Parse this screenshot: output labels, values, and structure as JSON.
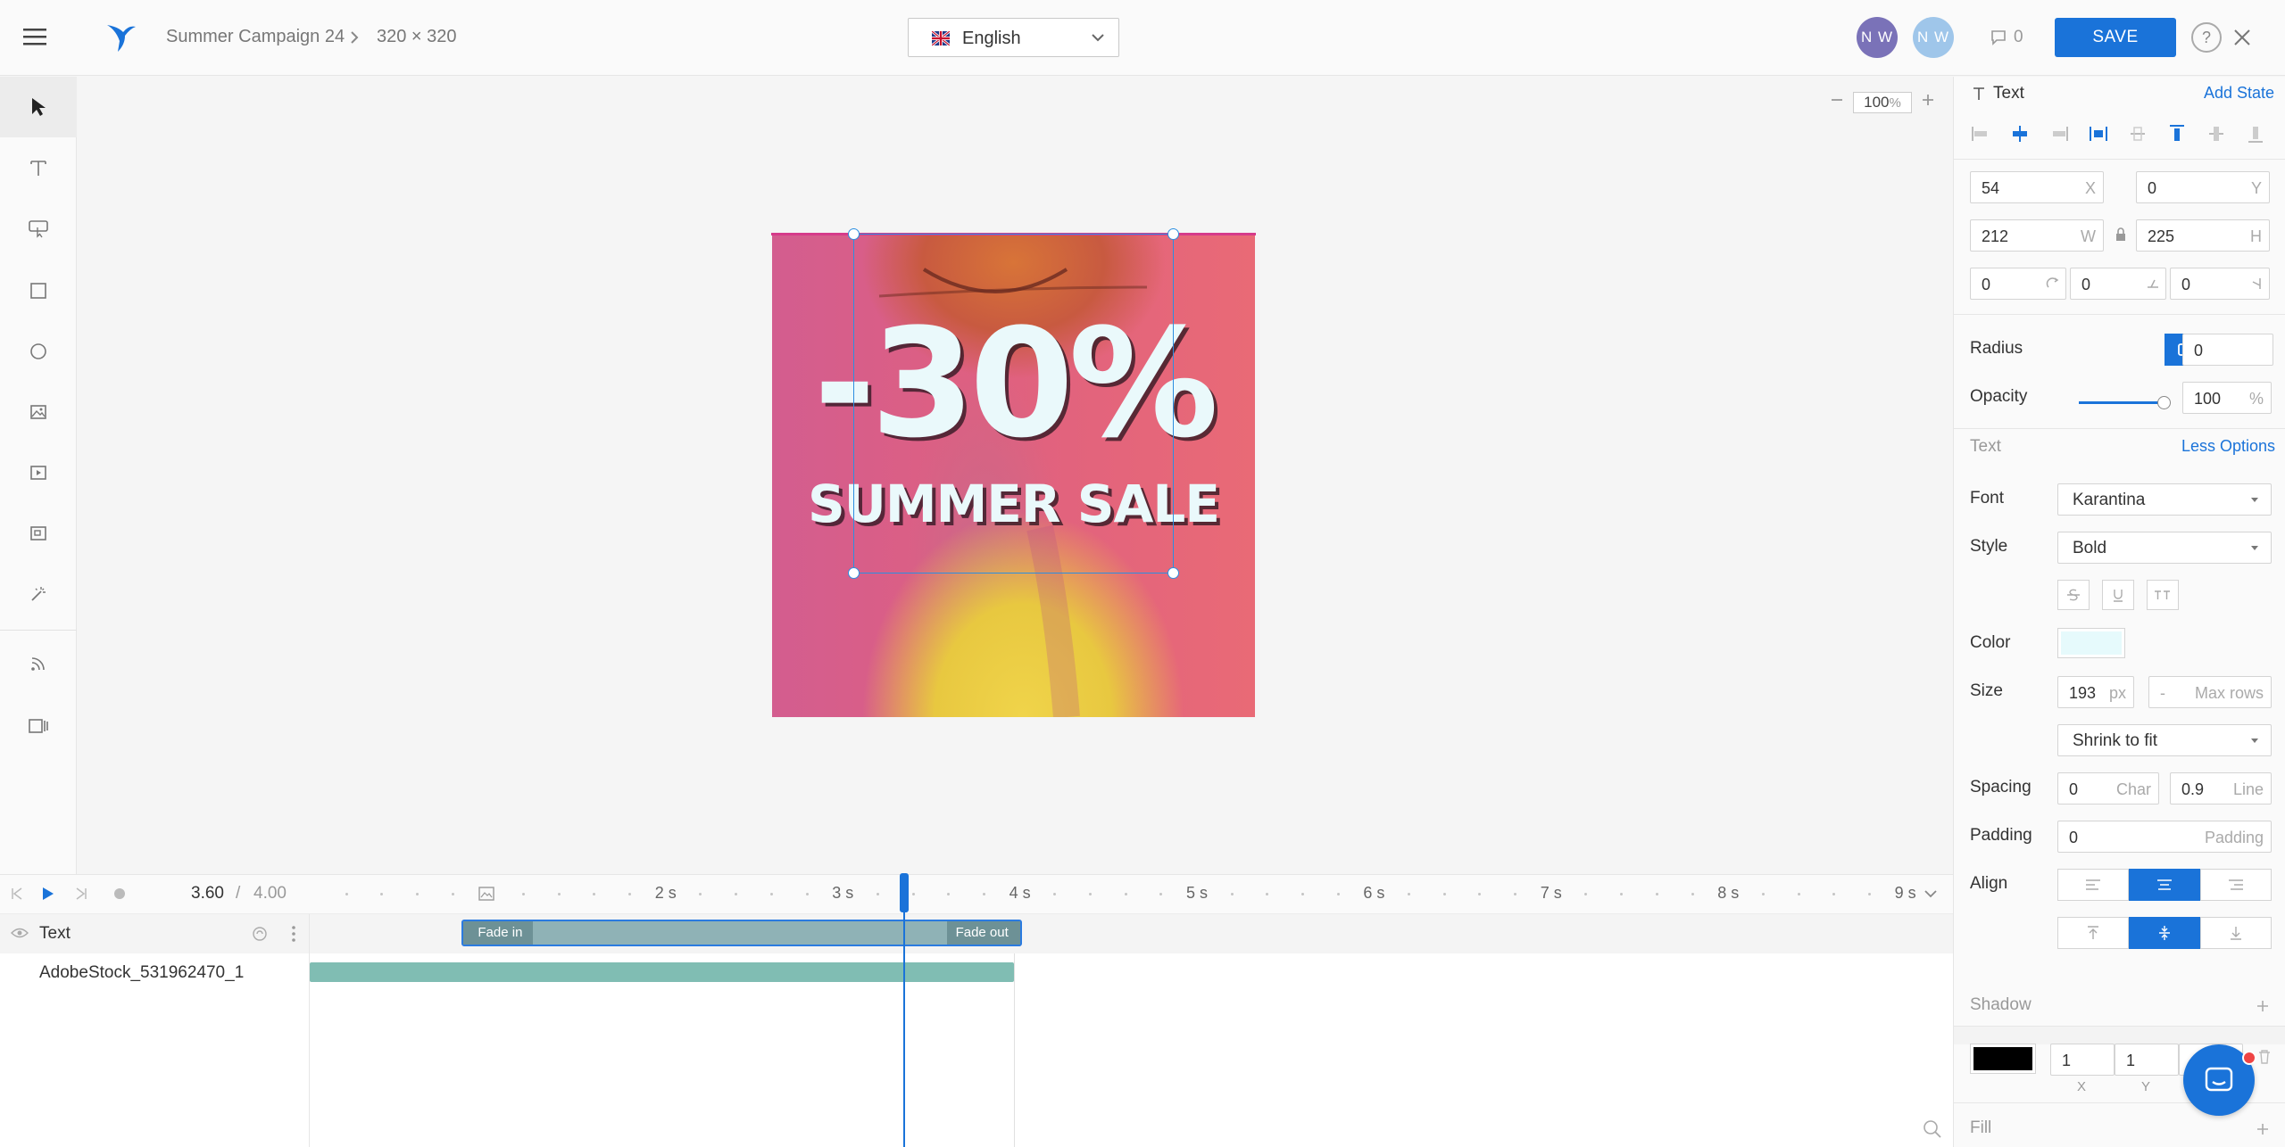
{
  "header": {
    "breadcrumb_project": "Summer Campaign 24",
    "breadcrumb_size": "320 × 320",
    "language": "English",
    "avatars": [
      {
        "initials": "N W",
        "color": "#7a72b8"
      },
      {
        "initials": "N W",
        "color": "#9fc6ea"
      }
    ],
    "comments_count": "0",
    "save_label": "SAVE",
    "help_label": "?"
  },
  "canvas": {
    "zoom_value": "100",
    "zoom_unit": "%",
    "artwork_headline": "-30%",
    "artwork_subline": "SUMMER SALE"
  },
  "panel": {
    "section_title": "Text",
    "add_state": "Add State",
    "x_value": "54",
    "x_label": "X",
    "y_value": "0",
    "y_label": "Y",
    "w_value": "212",
    "w_label": "W",
    "h_value": "225",
    "h_label": "H",
    "rot_value": "0",
    "skew_x_value": "0",
    "skew_y_value": "0",
    "radius_label": "Radius",
    "radius_value": "0",
    "opacity_label": "Opacity",
    "opacity_value": "100",
    "opacity_unit": "%",
    "opacity_level": 100,
    "text_section": "Text",
    "less_options": "Less Options",
    "font_label": "Font",
    "font_value": "Karantina",
    "style_label": "Style",
    "style_value": "Bold",
    "color_label": "Color",
    "color_value": "#e6fafc",
    "size_label": "Size",
    "size_value": "193",
    "size_unit": "px",
    "max_rows_value": "-",
    "max_rows_label": "Max rows",
    "fit_mode": "Shrink to fit",
    "spacing_label": "Spacing",
    "char_value": "0",
    "char_label": "Char",
    "line_value": "0.9",
    "line_label": "Line",
    "padding_label": "Padding",
    "padding_value": "0",
    "padding_placeholder": "Padding",
    "align_label": "Align",
    "shadow_label": "Shadow",
    "shadow_color": "#000000",
    "shadow_x": "1",
    "shadow_y": "1",
    "shadow_x_label": "X",
    "shadow_y_label": "Y",
    "fill_label": "Fill"
  },
  "timeline": {
    "current_time": "3.60",
    "separator": "/",
    "total_time": "4.00",
    "ticks": [
      "2 s",
      "3 s",
      "4 s",
      "5 s",
      "6 s",
      "7 s",
      "8 s",
      "9 s"
    ],
    "playhead_seconds": 3.6,
    "layers": [
      {
        "name": "Text",
        "clip_start": 1,
        "clip_end": 4,
        "fade_in": "Fade in",
        "fade_out": "Fade out"
      },
      {
        "name": "AdobeStock_531962470_1",
        "clip_start": 0,
        "clip_end": 4
      }
    ]
  }
}
